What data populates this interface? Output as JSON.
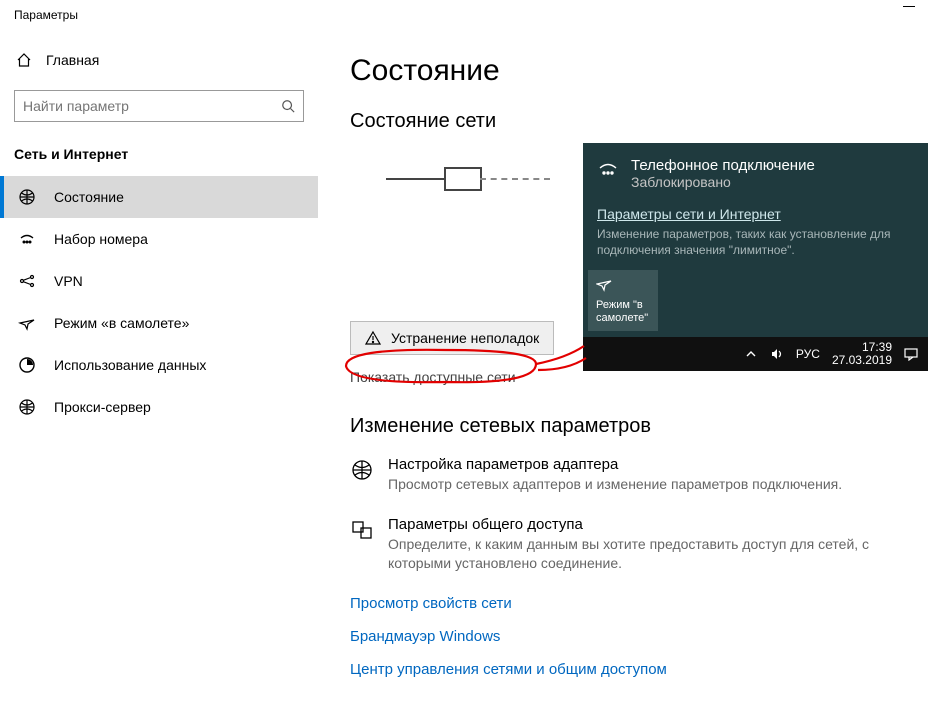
{
  "window": {
    "title": "Параметры"
  },
  "sidebar": {
    "home": "Главная",
    "search_placeholder": "Найти параметр",
    "category": "Сеть и Интернет",
    "items": [
      {
        "icon": "status",
        "label": "Состояние",
        "selected": true
      },
      {
        "icon": "dialup",
        "label": "Набор номера"
      },
      {
        "icon": "vpn",
        "label": "VPN"
      },
      {
        "icon": "airplane",
        "label": "Режим «в самолете»"
      },
      {
        "icon": "data",
        "label": "Использование данных"
      },
      {
        "icon": "proxy",
        "label": "Прокси-сервер"
      }
    ]
  },
  "main": {
    "title": "Состояние",
    "net_status_heading": "Состояние сети",
    "troubleshoot": "Устранение неполадок",
    "show_networks": "Показать доступные сети",
    "change_heading": "Изменение сетевых параметров",
    "adapter": {
      "title": "Настройка параметров адаптера",
      "desc": "Просмотр сетевых адаптеров и изменение параметров подключения."
    },
    "sharing": {
      "title": "Параметры общего доступа",
      "desc": "Определите, к каким данным вы хотите предоставить доступ для сетей, с которыми установлено соединение."
    },
    "link_props": "Просмотр свойств сети",
    "link_firewall": "Брандмауэр Windows",
    "link_sharing_center": "Центр управления сетями и общим доступом"
  },
  "flyout": {
    "conn_name": "Телефонное подключение",
    "conn_status": "Заблокировано",
    "settings_link": "Параметры сети и Интернет",
    "settings_desc": "Изменение параметров, таких как установление для подключения значения \"лимитное\".",
    "airplane_tile": "Режим \"в самолете\""
  },
  "taskbar": {
    "lang": "РУС",
    "time": "17:39",
    "date": "27.03.2019"
  }
}
